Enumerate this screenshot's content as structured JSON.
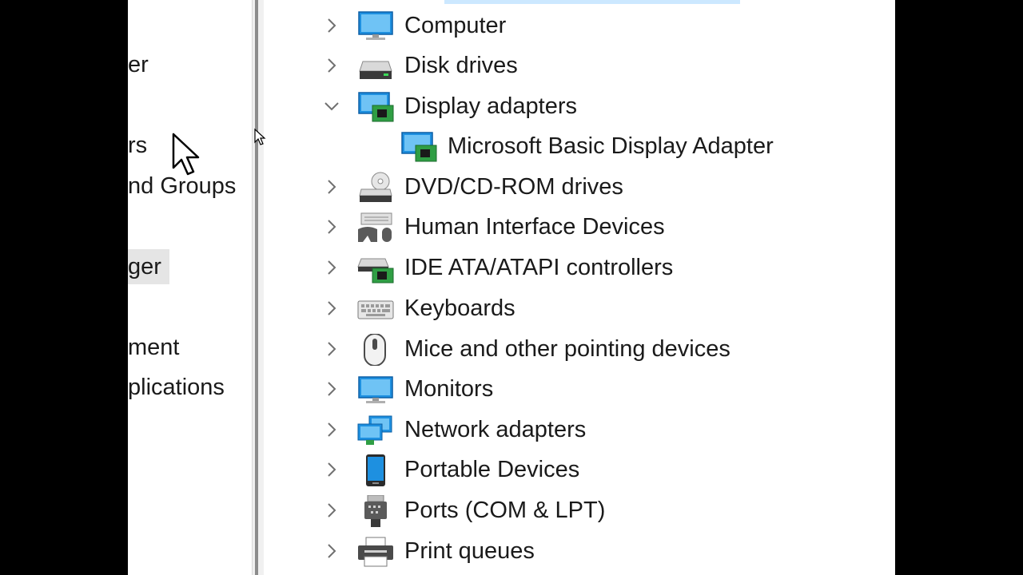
{
  "left_pane": {
    "items": [
      {
        "label": "er",
        "selected": false
      },
      {
        "label": "rs",
        "selected": false
      },
      {
        "label": "nd Groups",
        "selected": false
      },
      {
        "label": "ger",
        "selected": true
      },
      {
        "label": "ment",
        "selected": false
      },
      {
        "label": "plications",
        "selected": false
      }
    ]
  },
  "tree": {
    "items": [
      {
        "label": "Computer",
        "icon": "computer-icon",
        "expanded": false
      },
      {
        "label": "Disk drives",
        "icon": "disk-drive-icon",
        "expanded": false
      },
      {
        "label": "Display adapters",
        "icon": "display-adapter-icon",
        "expanded": true
      },
      {
        "label": "Microsoft Basic Display Adapter",
        "icon": "display-adapter-icon",
        "child": true
      },
      {
        "label": "DVD/CD-ROM drives",
        "icon": "dvd-drive-icon",
        "expanded": false
      },
      {
        "label": "Human Interface Devices",
        "icon": "hid-icon",
        "expanded": false
      },
      {
        "label": "IDE ATA/ATAPI controllers",
        "icon": "ide-controller-icon",
        "expanded": false
      },
      {
        "label": "Keyboards",
        "icon": "keyboard-icon",
        "expanded": false
      },
      {
        "label": "Mice and other pointing devices",
        "icon": "mouse-icon",
        "expanded": false
      },
      {
        "label": "Monitors",
        "icon": "monitor-icon",
        "expanded": false
      },
      {
        "label": "Network adapters",
        "icon": "network-adapter-icon",
        "expanded": false
      },
      {
        "label": "Portable Devices",
        "icon": "portable-device-icon",
        "expanded": false
      },
      {
        "label": "Ports (COM & LPT)",
        "icon": "port-icon",
        "expanded": false
      },
      {
        "label": "Print queues",
        "icon": "printer-icon",
        "expanded": false
      }
    ]
  },
  "colors": {
    "selection": "#cce8ff",
    "selected_nav": "#e5e5e5",
    "icon_blue": "#1e90e0",
    "chevron": "#707070"
  }
}
